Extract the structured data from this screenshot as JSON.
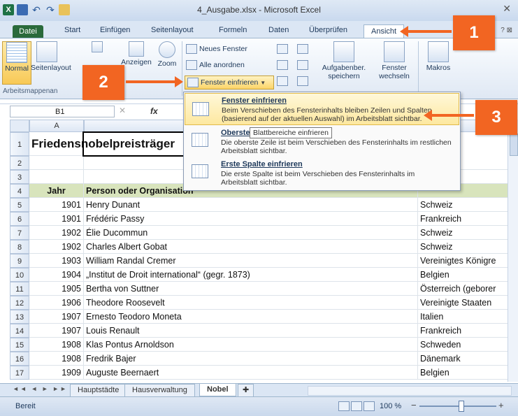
{
  "window": {
    "title": "4_Ausgabe.xlsx - Microsoft Excel",
    "logo": "X",
    "close": "✕"
  },
  "ribbon_tabs": [
    "Datei",
    "Start",
    "Einfügen",
    "Seitenlayout",
    "Formeln",
    "Daten",
    "Überprüfen",
    "Ansicht"
  ],
  "ribbon": {
    "normal": "Normal",
    "seitenlayout": "Seitenlayout",
    "anzeigen": "Anzeigen",
    "zoom": "Zoom",
    "neues_fenster": "Neues Fenster",
    "alle_anordnen": "Alle anordnen",
    "fenster_einfrieren": "Fenster einfrieren",
    "aufgabenber": "Aufgabenber.",
    "speichern": "speichern",
    "fenster": "Fenster",
    "wechseln": "wechseln",
    "makros": "Makros",
    "group_label": "Arbeitsmappenan"
  },
  "formula_bar": {
    "cell_ref": "B1",
    "fx": "fx",
    "cancel": "✕"
  },
  "columns": [
    "A",
    "B"
  ],
  "rows": [
    {
      "n": "1",
      "a": "Friedensnobelpreisträger",
      "b": "",
      "c": ""
    },
    {
      "n": "2",
      "a": "",
      "b": "",
      "c": ""
    },
    {
      "n": "3",
      "a": "",
      "b": "",
      "c": ""
    },
    {
      "n": "4",
      "a": "Jahr",
      "b": "Person oder Organisation",
      "c": ""
    },
    {
      "n": "5",
      "a": "1901",
      "b": "Henry Dunant",
      "c": "Schweiz"
    },
    {
      "n": "6",
      "a": "1901",
      "b": "Frédéric Passy",
      "c": "Frankreich"
    },
    {
      "n": "7",
      "a": "1902",
      "b": "Élie Ducommun",
      "c": "Schweiz"
    },
    {
      "n": "8",
      "a": "1902",
      "b": "Charles Albert Gobat",
      "c": "Schweiz"
    },
    {
      "n": "9",
      "a": "1903",
      "b": "William Randal Cremer",
      "c": "Vereinigtes Königre"
    },
    {
      "n": "10",
      "a": "1904",
      "b": "„Institut de Droit international“ (gegr. 1873)",
      "c": "Belgien"
    },
    {
      "n": "11",
      "a": "1905",
      "b": "Bertha von Suttner",
      "c": "Österreich (geborer"
    },
    {
      "n": "12",
      "a": "1906",
      "b": "Theodore Roosevelt",
      "c": "Vereinigte Staaten"
    },
    {
      "n": "13",
      "a": "1907",
      "b": "Ernesto Teodoro Moneta",
      "c": "Italien"
    },
    {
      "n": "14",
      "a": "1907",
      "b": "Louis Renault",
      "c": "Frankreich"
    },
    {
      "n": "15",
      "a": "1908",
      "b": "Klas Pontus Arnoldson",
      "c": "Schweden"
    },
    {
      "n": "16",
      "a": "1908",
      "b": "Fredrik Bajer",
      "c": "Dänemark"
    },
    {
      "n": "17",
      "a": "1909",
      "b": "Auguste Beernaert",
      "c": "Belgien"
    }
  ],
  "menu": {
    "items": [
      {
        "title": "Fenster einfrieren",
        "desc": "Beim Verschieben des Fensterinhalts bleiben Zeilen und Spalten (basierend auf der aktuellen Auswahl) im Arbeitsblatt sichtbar."
      },
      {
        "title": "Oberste Zeile einfrieren",
        "desc": "Die oberste Zeile ist beim Verschieben des Fensterinhalts im restlichen Arbeitsblatt sichtbar."
      },
      {
        "title": "Erste Spalte einfrieren",
        "desc": "Die erste Spalte ist beim Verschieben des Fensterinhalts im Arbeitsblatt sichtbar."
      }
    ],
    "tooltip": "Blattbereiche einfrieren"
  },
  "sheet_tabs": [
    "Hauptstädte",
    "Hausverwaltung",
    "Nobel"
  ],
  "status": {
    "ready": "Bereit",
    "zoom": "100 %",
    "minus": "−",
    "plus": "+"
  },
  "callouts": [
    "1",
    "2",
    "3"
  ],
  "colors": {
    "accent_orange": "#f26522",
    "file_tab_green": "#2a6a3b",
    "header_row_green": "#d8e4bc"
  }
}
